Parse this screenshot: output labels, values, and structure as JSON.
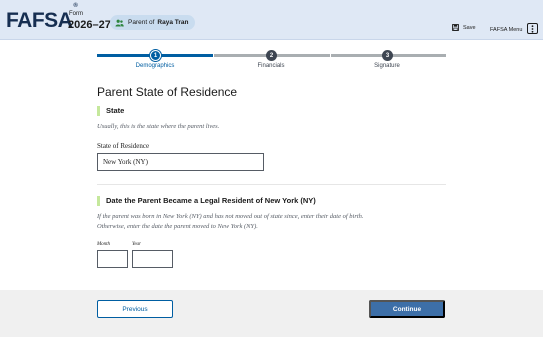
{
  "header": {
    "logo": "FAFSA",
    "logo_mark": "®",
    "form_label": "Form",
    "form_year": "2026–27",
    "parent_prefix": "Parent of",
    "parent_name": "Raya Tran",
    "save_label": "Save",
    "menu_label": "FAFSA Menu"
  },
  "stepper": {
    "steps": [
      {
        "number": "1",
        "label": "Demographics",
        "state": "current"
      },
      {
        "number": "2",
        "label": "Financials",
        "state": "upcoming"
      },
      {
        "number": "3",
        "label": "Signature",
        "state": "upcoming"
      }
    ]
  },
  "main": {
    "title": "Parent State of Residence",
    "state_section": {
      "heading": "State",
      "hint": "Usually, this is the state where the parent lives.",
      "field_label": "State of Residence",
      "field_value": "New York (NY)"
    },
    "date_section": {
      "heading": "Date the Parent Became a Legal Resident of New York (NY)",
      "hint_line1": "If the parent was born in New York (NY) and has not moved out of state since, enter their date of birth.",
      "hint_line2": "Otherwise, enter the date the parent moved to New York (NY).",
      "month_label": "Month",
      "year_label": "Year",
      "month_value": "",
      "year_value": ""
    }
  },
  "footer": {
    "previous_label": "Previous",
    "continue_label": "Continue"
  },
  "colors": {
    "header_bg": "#dfe8f5",
    "primary": "#005ea2",
    "continue_bg": "#3d6fa8",
    "accent_bar": "#c5e89c",
    "footer_bg": "#f0f0f0"
  }
}
